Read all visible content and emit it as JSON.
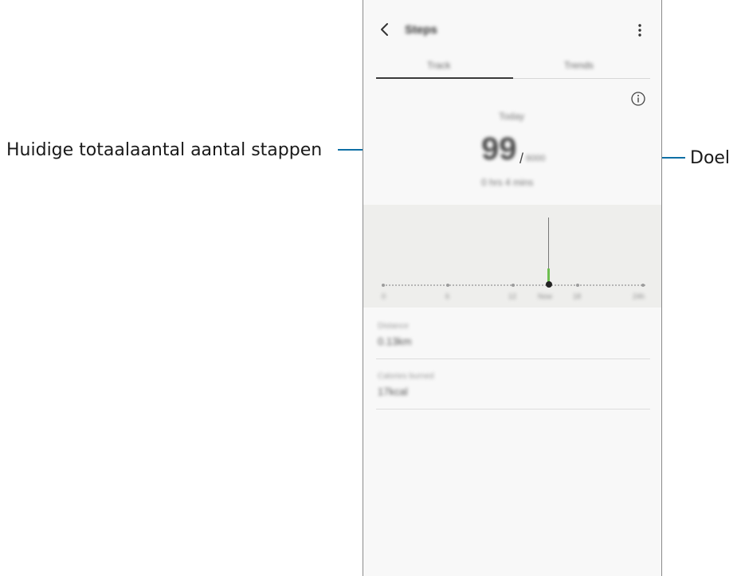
{
  "annotations": {
    "left_label": "Huidige totaalaantal aantal stappen",
    "right_label": "Doel"
  },
  "app": {
    "title": "Steps",
    "tabs": [
      "Track",
      "Trends"
    ],
    "active_tab": "Track",
    "today_label": "Today",
    "current_steps": "99",
    "separator": "/",
    "goal": "6000",
    "active_time": "0 hrs 4 mins"
  },
  "chart": {
    "axis_labels": [
      "0",
      "6",
      "12",
      "Now",
      "18",
      "24h"
    ]
  },
  "stats": [
    {
      "label": "Distance",
      "value": "0.13km"
    },
    {
      "label": "Calories burned",
      "value": "17kcal"
    }
  ],
  "colors": {
    "callout_line": "#0e6fa5",
    "chart_bar": "#6dbf4f",
    "chart_bg": "#eeeeec"
  }
}
